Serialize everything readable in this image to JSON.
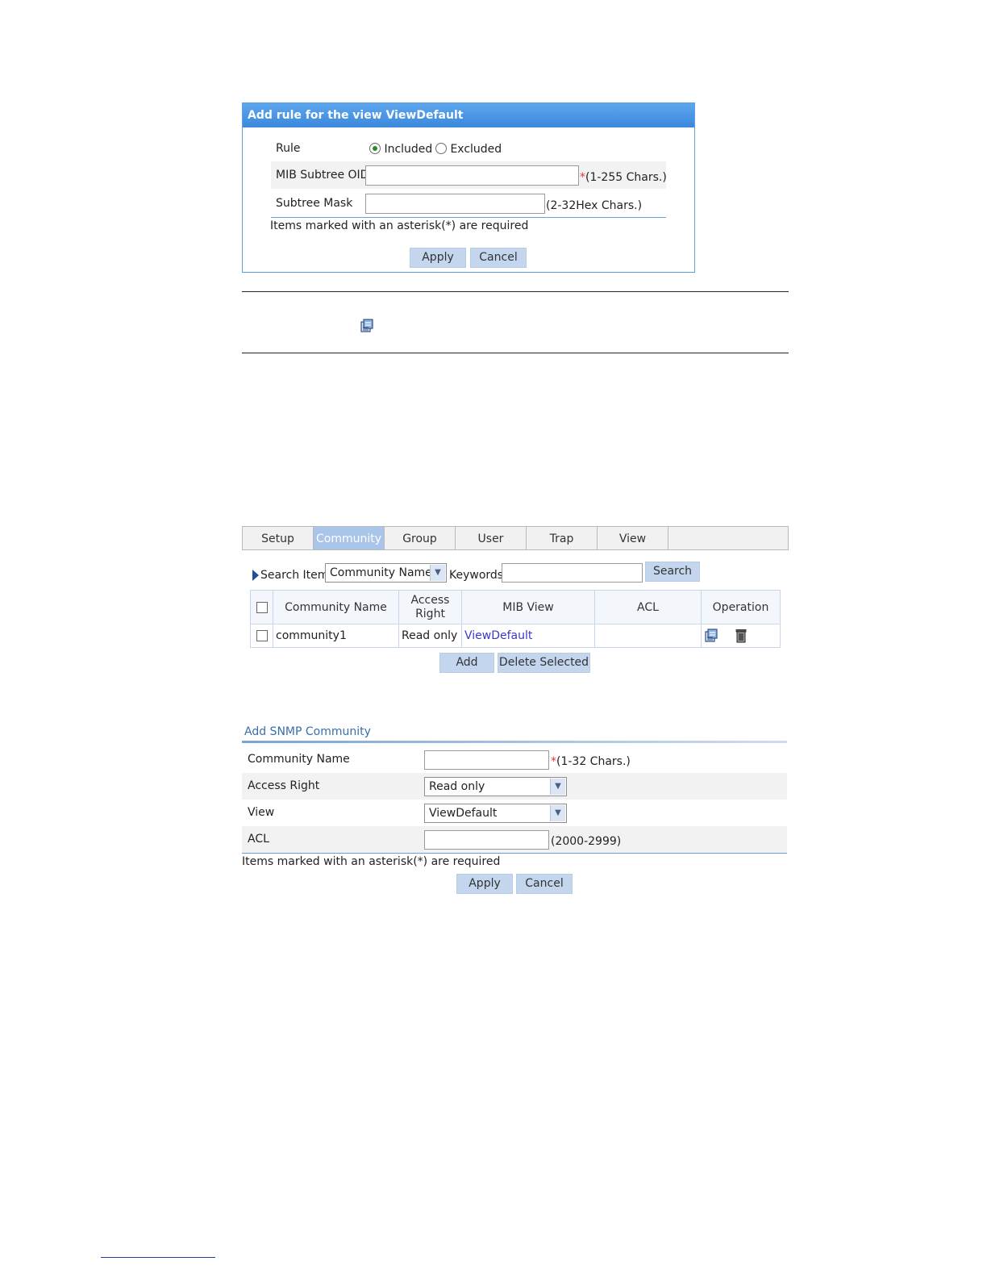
{
  "rule_dialog": {
    "title": "Add rule for the view ViewDefault",
    "rule_label": "Rule",
    "included_label": "Included",
    "excluded_label": "Excluded",
    "oid_label": "MIB Subtree OID",
    "oid_value": "",
    "oid_hint_req": "*",
    "oid_hint": "(1-255 Chars.)",
    "mask_label": "Subtree Mask",
    "mask_value": "",
    "mask_hint": "(2-32Hex Chars.)",
    "required_note": "Items marked with an asterisk(*) are required",
    "apply_label": "Apply",
    "cancel_label": "Cancel"
  },
  "tabs": [
    "Setup",
    "Community",
    "Group",
    "User",
    "Trap",
    "View"
  ],
  "search": {
    "item_label": "Search Item:",
    "item_selected": "Community Name",
    "keywords_label": "Keywords:",
    "keywords_value": "",
    "search_label": "Search"
  },
  "table": {
    "headers": {
      "community_name": "Community Name",
      "access_right_1": "Access",
      "access_right_2": "Right",
      "mib_view": "MIB View",
      "acl": "ACL",
      "operation": "Operation"
    },
    "rows": [
      {
        "community_name": "community1",
        "access_right": "Read only",
        "mib_view": "ViewDefault",
        "acl": ""
      }
    ],
    "add_label": "Add",
    "delete_selected_label": "Delete Selected"
  },
  "community_form": {
    "title": "Add SNMP Community",
    "name_label": "Community Name",
    "name_value": "",
    "name_hint_req": "*",
    "name_hint": "(1-32 Chars.)",
    "access_label": "Access Right",
    "access_selected": "Read only",
    "view_label": "View",
    "view_selected": "ViewDefault",
    "acl_label": "ACL",
    "acl_value": "",
    "acl_hint": "(2000-2999)",
    "required_note": "Items marked with an asterisk(*) are required",
    "apply_label": "Apply",
    "cancel_label": "Cancel"
  },
  "icons": {
    "edit": "edit-icon",
    "delete": "trash-icon",
    "triangle": "triangle-right-icon"
  }
}
